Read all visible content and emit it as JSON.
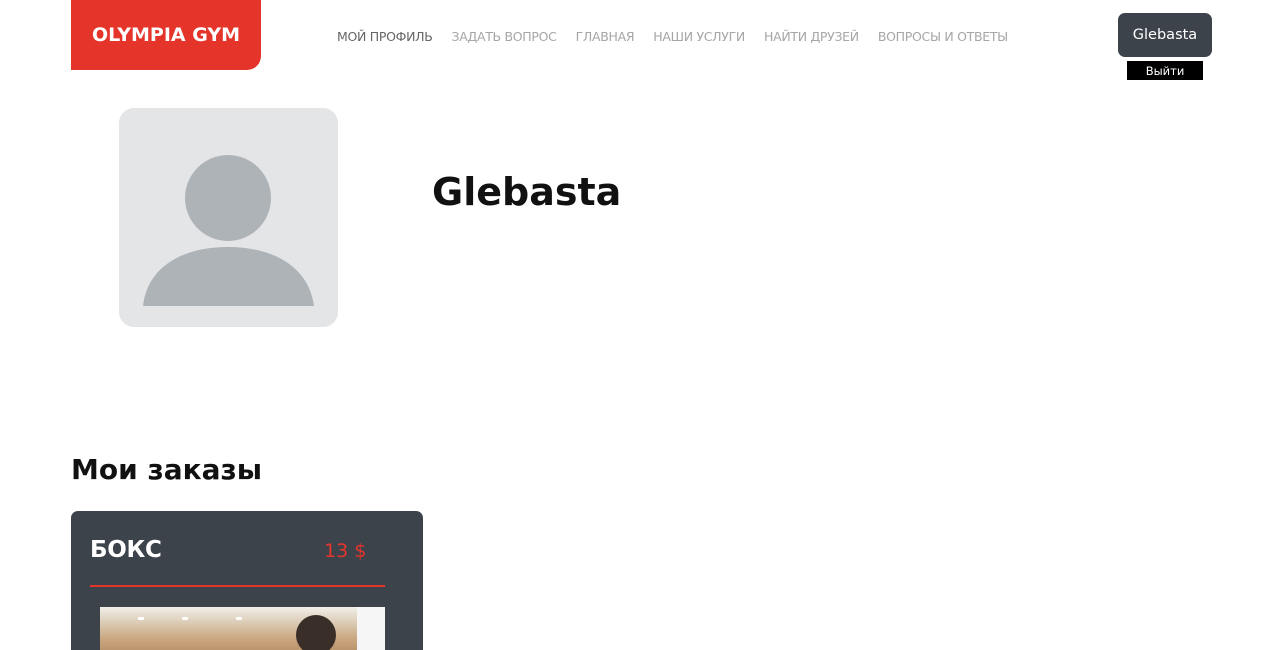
{
  "brand": {
    "logo_text": "OLYMPIA GYM",
    "accent_color": "#e5342a",
    "dark_color": "#3d434b"
  },
  "nav": {
    "items": [
      {
        "label": "МОЙ ПРОФИЛЬ",
        "active": true
      },
      {
        "label": "ЗАДАТЬ ВОПРОС",
        "active": false
      },
      {
        "label": "ГЛАВНАЯ",
        "active": false
      },
      {
        "label": "НАШИ УСЛУГИ",
        "active": false
      },
      {
        "label": "НАЙТИ ДРУЗЕЙ",
        "active": false
      },
      {
        "label": "ВОПРОСЫ И ОТВЕТЫ",
        "active": false
      }
    ]
  },
  "user": {
    "username": "Glebasta",
    "logout_label": "Выйти"
  },
  "profile": {
    "name": "Glebasta",
    "avatar_icon": "user-silhouette-icon"
  },
  "orders": {
    "title": "Мои заказы",
    "items": [
      {
        "name": "БОКС",
        "price": "13 $"
      }
    ]
  }
}
